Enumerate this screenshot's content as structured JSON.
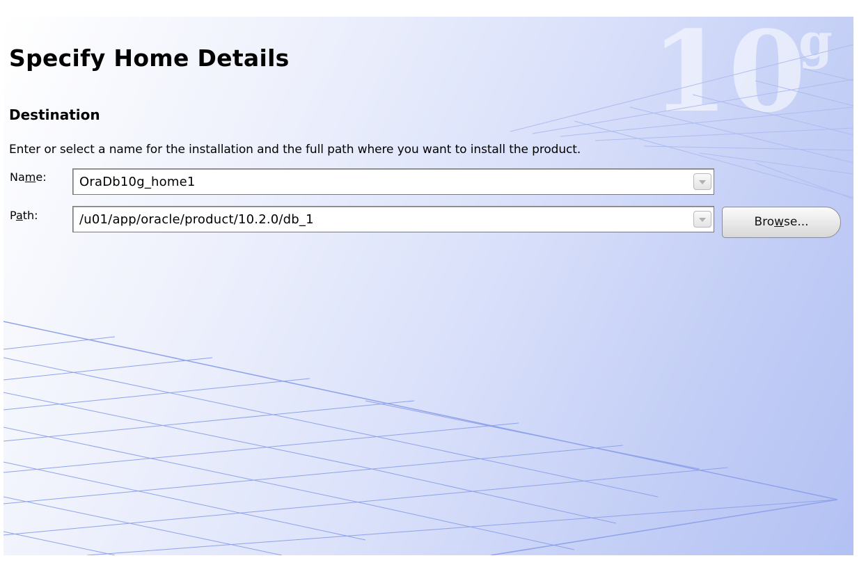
{
  "page": {
    "title": "Specify Home Details",
    "watermark": "10",
    "watermark_small": "g"
  },
  "destination": {
    "section_title": "Destination",
    "instructions": "Enter or select a name for the installation and the full path where you want to install the product.",
    "name": {
      "label_before": "Na",
      "label_mnemonic": "m",
      "label_after": "e:",
      "value": "OraDb10g_home1"
    },
    "path": {
      "label_before": "P",
      "label_mnemonic": "a",
      "label_after": "th:",
      "value": "/u01/app/oracle/product/10.2.0/db_1"
    },
    "browse": {
      "label_before": "Bro",
      "label_mnemonic": "w",
      "label_after": "se..."
    }
  },
  "colors": {
    "background_light": "#ffffff",
    "background_dark": "#b3c1f3",
    "grid_line": "#8fa2ea"
  }
}
